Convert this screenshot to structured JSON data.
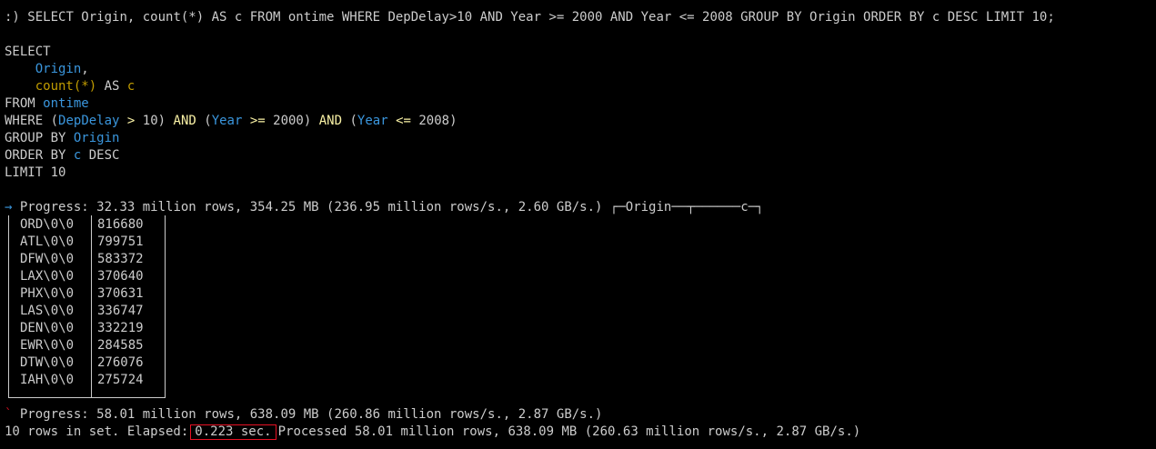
{
  "input_line": {
    "prompt": ":)",
    "command": "SELECT Origin, count(*) AS c FROM ontime WHERE DepDelay>10 AND Year >= 2000 AND Year <= 2008 GROUP BY Origin ORDER BY c DESC LIMIT 10;"
  },
  "formatted_query": {
    "select": "SELECT",
    "col1": "Origin",
    "col1_comma": ",",
    "count_fn": "count(*)",
    "as": "AS",
    "alias": "c",
    "from": "FROM",
    "table": "ontime",
    "where": "WHERE",
    "open1": "(",
    "depdelay": "DepDelay",
    "gt": ">",
    "v10": "10)",
    "and1": "AND",
    "open2": "(",
    "year1": "Year",
    "gte": ">=",
    "v2000": "2000)",
    "and2": "AND",
    "open3": "(",
    "year2": "Year",
    "lte": "<=",
    "v2008": "2008)",
    "group_by": "GROUP BY",
    "group_col": "Origin",
    "order_by": "ORDER BY",
    "order_col": "c",
    "desc": "DESC",
    "limit": "LIMIT",
    "limit_val": "10"
  },
  "progress1": {
    "arrow": "→",
    "text": "Progress: 32.33 million rows, 354.25 MB (236.95 million rows/s., 2.60 GB/s.)"
  },
  "table": {
    "header_left": "┌─",
    "col_origin": "Origin",
    "header_mid": "──┬──────",
    "col_c": "c",
    "header_right": "─┐",
    "rows": [
      {
        "origin": "ORD\\0\\0",
        "c": "816680"
      },
      {
        "origin": "ATL\\0\\0",
        "c": "799751"
      },
      {
        "origin": "DFW\\0\\0",
        "c": "583372"
      },
      {
        "origin": "LAX\\0\\0",
        "c": "370640"
      },
      {
        "origin": "PHX\\0\\0",
        "c": "370631"
      },
      {
        "origin": "LAS\\0\\0",
        "c": "336747"
      },
      {
        "origin": "DEN\\0\\0",
        "c": "332219"
      },
      {
        "origin": "EWR\\0\\0",
        "c": "284585"
      },
      {
        "origin": "DTW\\0\\0",
        "c": "276076"
      },
      {
        "origin": "IAH\\0\\0",
        "c": "275724"
      }
    ]
  },
  "progress2": {
    "spinner": "`",
    "text": "Progress: 58.01 million rows, 638.09 MB (260.86 million rows/s., 2.87 GB/s.)"
  },
  "summary": {
    "prefix": "10 rows in set. Elapsed:",
    "elapsed": "0.223 sec.",
    "suffix": "Processed 58.01 million rows, 638.09 MB (260.63 million rows/s., 2.87 GB/s.)"
  },
  "colors": {
    "background": "#000000",
    "text": "#cccccc",
    "identifier": "#3a96dd",
    "function": "#c19c00",
    "operator": "#f9f1a5",
    "highlight_box": "#e81123"
  }
}
